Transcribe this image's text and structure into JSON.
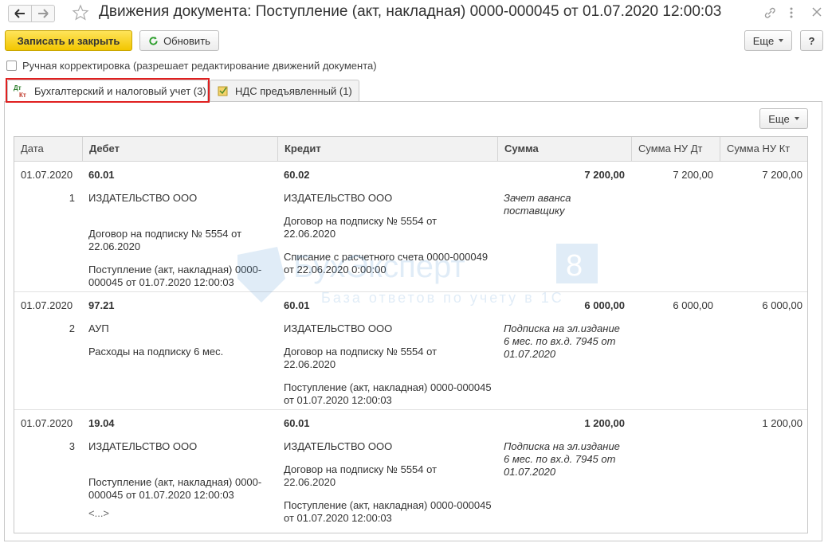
{
  "window": {
    "title": "Движения документа: Поступление (акт, накладная) 0000-000045 от 01.07.2020 12:00:03"
  },
  "toolbar": {
    "save_close": "Записать и закрыть",
    "refresh": "Обновить",
    "more": "Еще",
    "help": "?"
  },
  "manual": {
    "label": "Ручная корректировка (разрешает редактирование движений документа)"
  },
  "tabs": [
    {
      "icon_text": "Дт Кт",
      "label": "Бухгалтерский и налоговый учет (3)"
    },
    {
      "label": "НДС предъявленный (1)"
    }
  ],
  "panel": {
    "more": "Еще"
  },
  "table": {
    "columns": [
      "Дата",
      "Дебет",
      "Кредит",
      "Сумма",
      "Сумма НУ Дт",
      "Сумма НУ Кт"
    ],
    "rows": [
      {
        "date": "01.07.2020",
        "num": "1",
        "debit_account": "60.01",
        "debit_lines": [
          "ИЗДАТЕЛЬСТВО ООО",
          "Договор на подписку № 5554 от 22.06.2020",
          "Поступление (акт, накладная) 0000-000045 от 01.07.2020 12:00:03"
        ],
        "credit_account": "60.02",
        "credit_lines": [
          "ИЗДАТЕЛЬСТВО ООО",
          "Договор на подписку № 5554 от 22.06.2020",
          "Списание с расчетного счета 0000-000049 от 22.06.2020 0:00:00"
        ],
        "sum": "7 200,00",
        "content": "Зачет аванса поставщику",
        "nu_dt": "7 200,00",
        "nu_kt": "7 200,00"
      },
      {
        "date": "01.07.2020",
        "num": "2",
        "debit_account": "97.21",
        "debit_lines": [
          "АУП",
          "Расходы на подписку 6 мес."
        ],
        "credit_account": "60.01",
        "credit_lines": [
          "ИЗДАТЕЛЬСТВО ООО",
          "Договор на подписку № 5554 от 22.06.2020",
          "Поступление (акт, накладная) 0000-000045 от 01.07.2020 12:00:03"
        ],
        "sum": "6 000,00",
        "content": "Подписка на эл.издание 6 мес. по вх.д. 7945 от 01.07.2020",
        "nu_dt": "6 000,00",
        "nu_kt": "6 000,00"
      },
      {
        "date": "01.07.2020",
        "num": "3",
        "debit_account": "19.04",
        "debit_lines": [
          "ИЗДАТЕЛЬСТВО ООО",
          "Поступление (акт, накладная) 0000-000045 от 01.07.2020 12:00:03",
          "<...>"
        ],
        "credit_account": "60.01",
        "credit_lines": [
          "ИЗДАТЕЛЬСТВО ООО",
          "Договор на подписку № 5554 от 22.06.2020",
          "Поступление (акт, накладная) 0000-000045 от 01.07.2020 12:00:03"
        ],
        "sum": "1 200,00",
        "content": "Подписка на эл.издание 6 мес. по вх.д. 7945 от 01.07.2020",
        "nu_dt": "",
        "nu_kt": "1 200,00"
      }
    ]
  },
  "watermark": {
    "brand": "БухЭксперт",
    "number": "8",
    "tagline": "База ответов по учету в 1С"
  },
  "colors": {
    "accent_yellow": "#f2c600",
    "highlight_red": "#e02020",
    "watermark_blue": "#5b9bd5"
  }
}
